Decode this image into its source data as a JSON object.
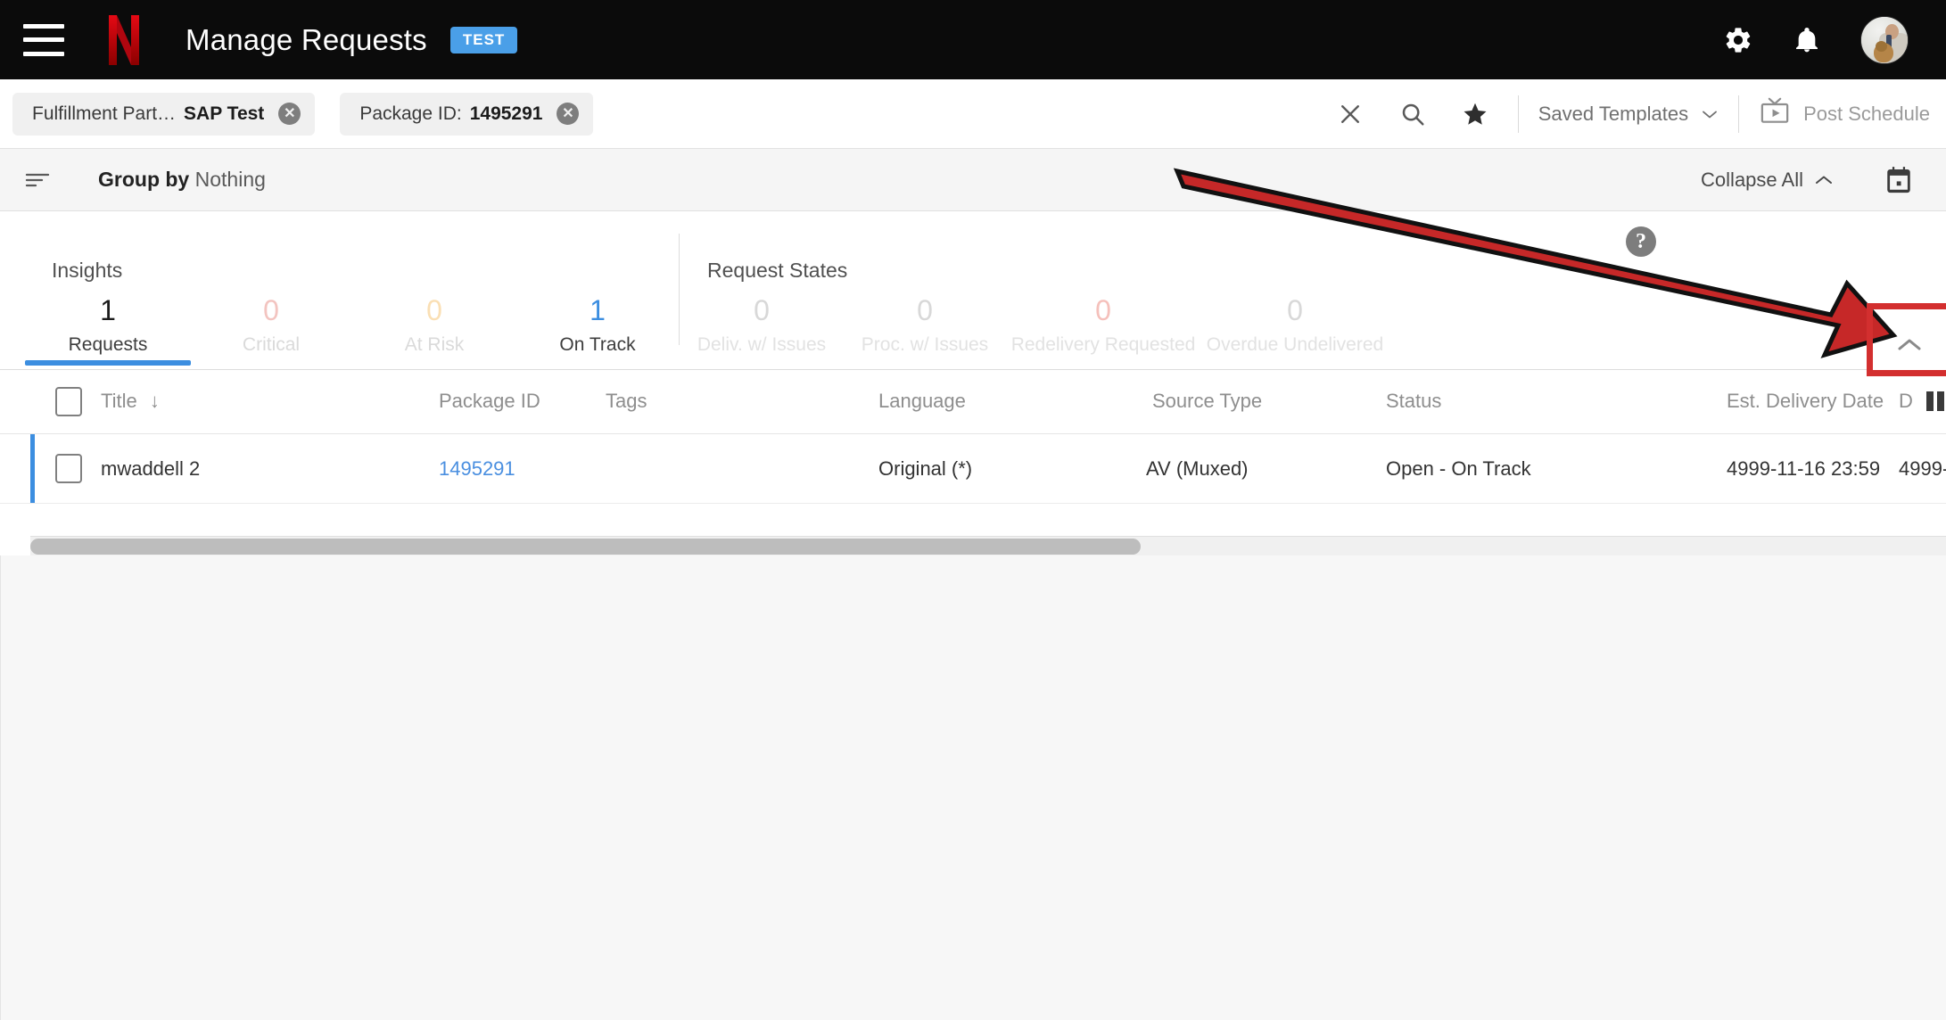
{
  "topnav": {
    "menu_icon": "hamburger-menu-icon",
    "logo": "netflix-logo",
    "title": "Manage Requests",
    "env_badge": "TEST",
    "settings_icon": "gear-icon",
    "notifications_icon": "bell-icon",
    "avatar": "user-avatar"
  },
  "filterbar": {
    "chips": [
      {
        "key": "Fulfillment Part…",
        "value": "SAP Test",
        "remove_icon": "remove-chip-icon"
      },
      {
        "key": "Package ID:",
        "value": "1495291",
        "remove_icon": "remove-chip-icon"
      }
    ],
    "clear_icon": "close-icon",
    "search_icon": "search-icon",
    "favorite_icon": "star-icon",
    "saved_templates_label": "Saved Templates",
    "saved_templates_chevron": "chevron-down-icon",
    "post_schedule_icon": "tv-icon",
    "post_schedule_label": "Post Schedule"
  },
  "groupbar": {
    "sort_icon": "sort-icon",
    "group_by_label": "Group by",
    "group_by_value": "Nothing",
    "collapse_all_label": "Collapse All",
    "collapse_all_chevron": "chevron-up-icon",
    "calendar_icon": "calendar-icon"
  },
  "insights": {
    "section_label": "Insights",
    "metrics": [
      {
        "value": "1",
        "label": "Requests",
        "value_color": "#1c1c1c",
        "label_color": "#3d3d3d",
        "active": true
      },
      {
        "value": "0",
        "label": "Critical",
        "value_color": "#f3c4c0",
        "label_color": "#d8d8d8",
        "active": false
      },
      {
        "value": "0",
        "label": "At Risk",
        "value_color": "#fadfb4",
        "label_color": "#d8d8d8",
        "active": false
      },
      {
        "value": "1",
        "label": "On Track",
        "value_color": "#3c8ee0",
        "label_color": "#3d3d3d",
        "active": false
      }
    ],
    "accent_color": "#3c8ee0"
  },
  "request_states": {
    "section_label": "Request States",
    "metrics": [
      {
        "value": "0",
        "label": "Deliv. w/ Issues",
        "value_color": "#d8d8d8",
        "label_color": "#e0e0e0"
      },
      {
        "value": "0",
        "label": "Proc. w/ Issues",
        "value_color": "#d8d8d8",
        "label_color": "#e0e0e0"
      },
      {
        "value": "0",
        "label": "Redelivery Requested",
        "value_color": "#f5c0bb",
        "label_color": "#e0e0e0"
      },
      {
        "value": "0",
        "label": "Overdue Undelivered",
        "value_color": "#d8d8d8",
        "label_color": "#e0e0e0"
      }
    ],
    "help_icon": "help-icon",
    "collapse_panel_icon": "chevron-up-icon"
  },
  "table": {
    "select_all_checkbox": "select-all-checkbox",
    "columns": [
      {
        "label": "Title",
        "sort_indicator": "↓"
      },
      {
        "label": "Package ID"
      },
      {
        "label": "Tags"
      },
      {
        "label": "Language"
      },
      {
        "label": "Source Type"
      },
      {
        "label": "Status"
      },
      {
        "label": "Est. Delivery Date"
      },
      {
        "label": "D"
      }
    ],
    "column_picker_icon": "columns-icon",
    "rows": [
      {
        "title": "mwaddell 2",
        "package_id": "1495291",
        "tags": "",
        "language": "Original (*)",
        "source_type": "AV (Muxed)",
        "status": "Open - On Track",
        "est_delivery_date": "4999-11-16 23:59",
        "delivery_date_partial": "4999-"
      }
    ],
    "scrollbar": "horizontal-scrollbar"
  },
  "annotations": {
    "arrow_color": "#c62828",
    "highlight_box_color": "#d32f2f"
  }
}
